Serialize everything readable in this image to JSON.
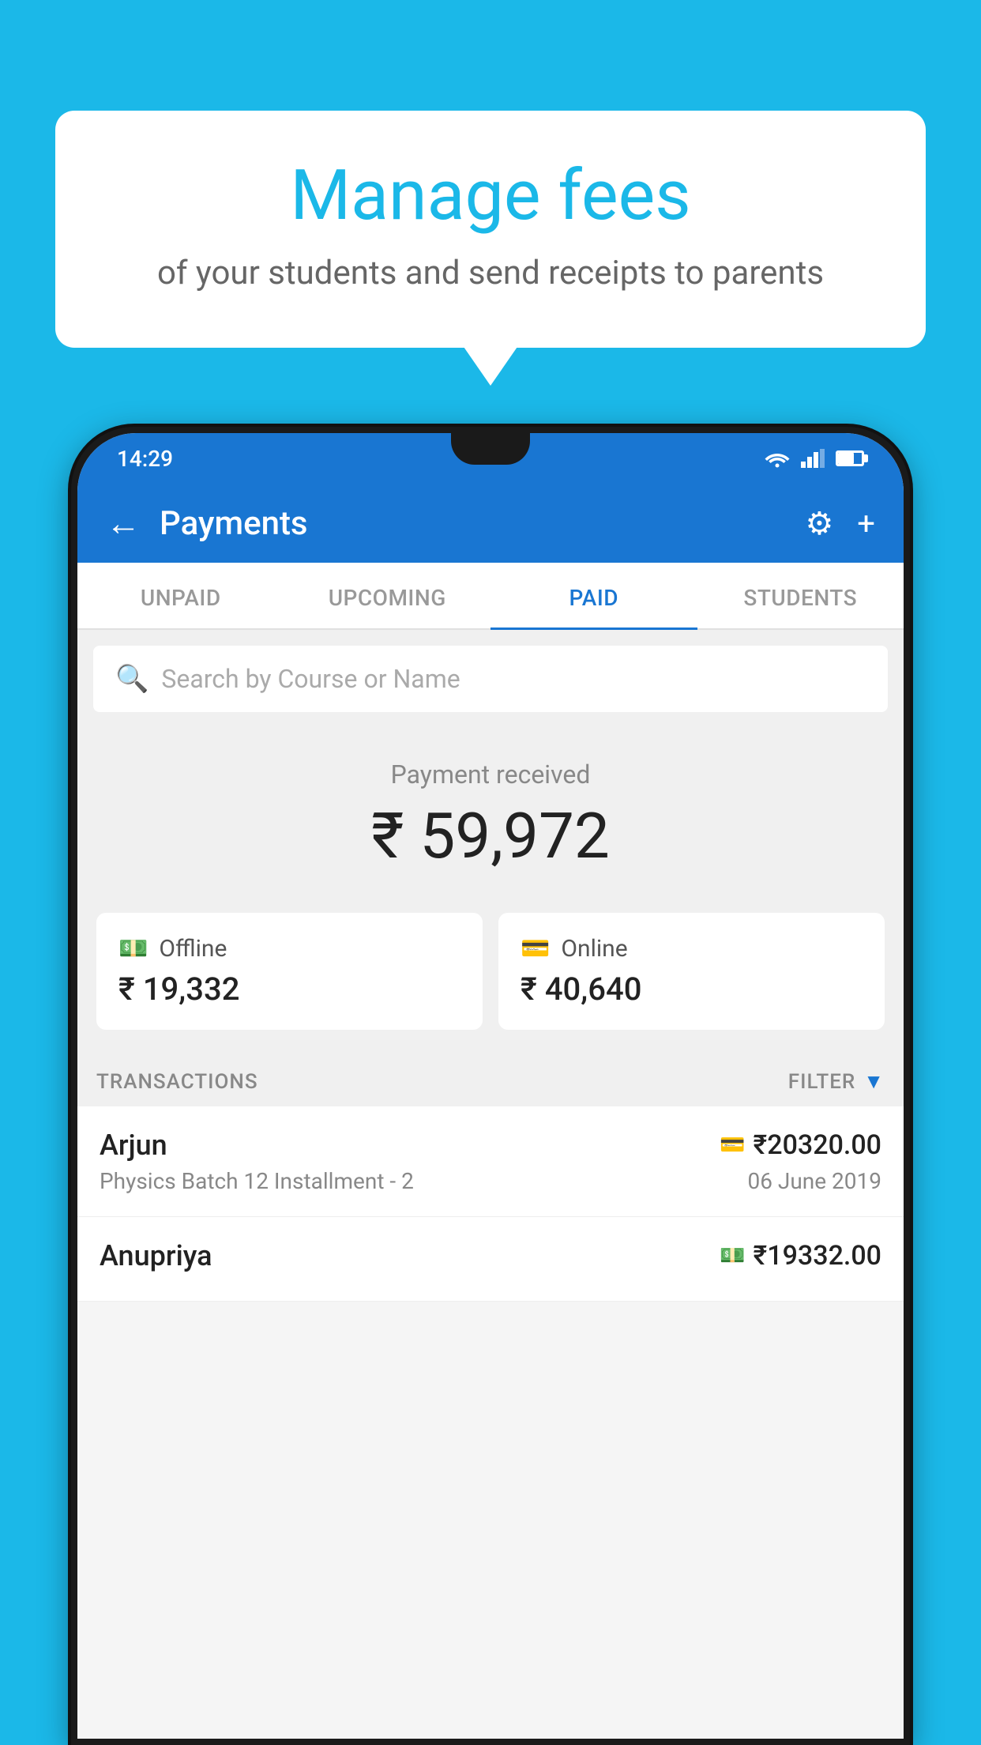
{
  "background_color": "#1BB8E8",
  "bubble": {
    "title": "Manage fees",
    "subtitle": "of your students and send receipts to parents"
  },
  "status_bar": {
    "time": "14:29"
  },
  "app_header": {
    "title": "Payments",
    "back_icon": "←",
    "settings_icon": "⚙",
    "add_icon": "+"
  },
  "tabs": [
    {
      "label": "UNPAID",
      "active": false
    },
    {
      "label": "UPCOMING",
      "active": false
    },
    {
      "label": "PAID",
      "active": true
    },
    {
      "label": "STUDENTS",
      "active": false
    }
  ],
  "search": {
    "placeholder": "Search by Course or Name"
  },
  "payment_section": {
    "received_label": "Payment received",
    "total_amount": "₹ 59,972",
    "offline_label": "Offline",
    "offline_amount": "₹ 19,332",
    "online_label": "Online",
    "online_amount": "₹ 40,640"
  },
  "transactions_header": {
    "label": "TRANSACTIONS",
    "filter_label": "FILTER"
  },
  "transactions": [
    {
      "name": "Arjun",
      "amount": "₹20320.00",
      "course": "Physics Batch 12 Installment - 2",
      "date": "06 June 2019",
      "method": "card"
    },
    {
      "name": "Anupriya",
      "amount": "₹19332.00",
      "course": "",
      "date": "",
      "method": "cash"
    }
  ]
}
